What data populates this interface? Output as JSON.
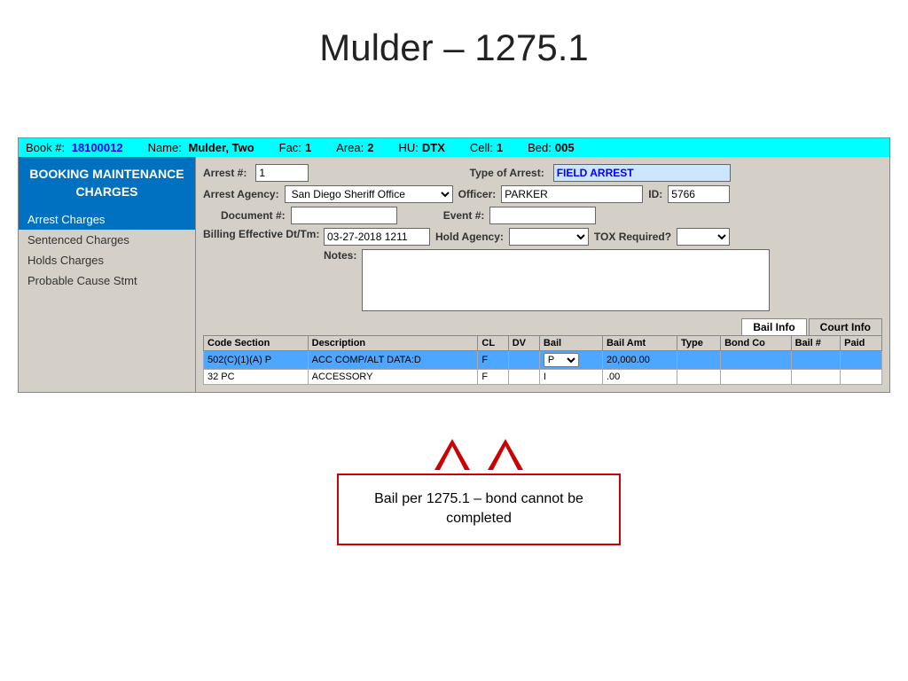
{
  "title": "Mulder – 1275.1",
  "header": {
    "book_label": "Book #:",
    "book_val": "18100012",
    "name_label": "Name:",
    "name_val": "Mulder, Two",
    "fac_label": "Fac:",
    "fac_val": "1",
    "area_label": "Area:",
    "area_val": "2",
    "hu_label": "HU:",
    "hu_val": "DTX",
    "cell_label": "Cell:",
    "cell_val": "1",
    "bed_label": "Bed:",
    "bed_val": "005"
  },
  "sidebar": {
    "title": "BOOKING MAINTENANCE CHARGES",
    "items": [
      {
        "label": "Arrest Charges",
        "active": true
      },
      {
        "label": "Sentenced Charges",
        "active": false
      },
      {
        "label": "Holds Charges",
        "active": false
      },
      {
        "label": "Probable Cause Stmt",
        "active": false
      }
    ]
  },
  "form": {
    "arrest_num_label": "Arrest #:",
    "arrest_num_val": "1",
    "type_of_arrest_label": "Type of Arrest:",
    "type_of_arrest_val": "FIELD ARREST",
    "arrest_agency_label": "Arrest Agency:",
    "arrest_agency_val": "San Diego Sheriff Office",
    "officer_label": "Officer:",
    "officer_val": "PARKER",
    "id_label": "ID:",
    "id_val": "5766",
    "document_label": "Document #:",
    "document_val": "",
    "event_label": "Event #:",
    "event_val": "",
    "billing_label": "Billing Effective Dt/Tm:",
    "billing_val": "03-27-2018 1211",
    "hold_agency_label": "Hold Agency:",
    "hold_agency_val": "",
    "tox_label": "TOX Required?",
    "tox_val": "",
    "notes_label": "Notes:",
    "notes_val": ""
  },
  "bail_info": {
    "tab_bail": "Bail Info",
    "tab_court": "Court Info"
  },
  "table": {
    "columns": [
      "Code Section",
      "Description",
      "CL",
      "DV",
      "Bail",
      "Bail Amt",
      "Type",
      "Bond Co",
      "Bail #",
      "Paid"
    ],
    "rows": [
      {
        "code": "502(C)(1)(A) P",
        "desc": "ACC COMP/ALT DATA:D",
        "cl": "F",
        "dv": "",
        "bail": "P",
        "bail_amt": "20,000.00",
        "type": "",
        "bond_co": "",
        "bail_num": "",
        "paid": "",
        "highlight": true
      },
      {
        "code": "32 PC",
        "desc": "ACCESSORY",
        "cl": "F",
        "dv": "",
        "bail": "I",
        "bail_amt": ".00",
        "type": "",
        "bond_co": "",
        "bail_num": "",
        "paid": "",
        "highlight": false
      }
    ]
  },
  "callout": {
    "text": "Bail per 1275.1 – bond cannot be completed"
  }
}
